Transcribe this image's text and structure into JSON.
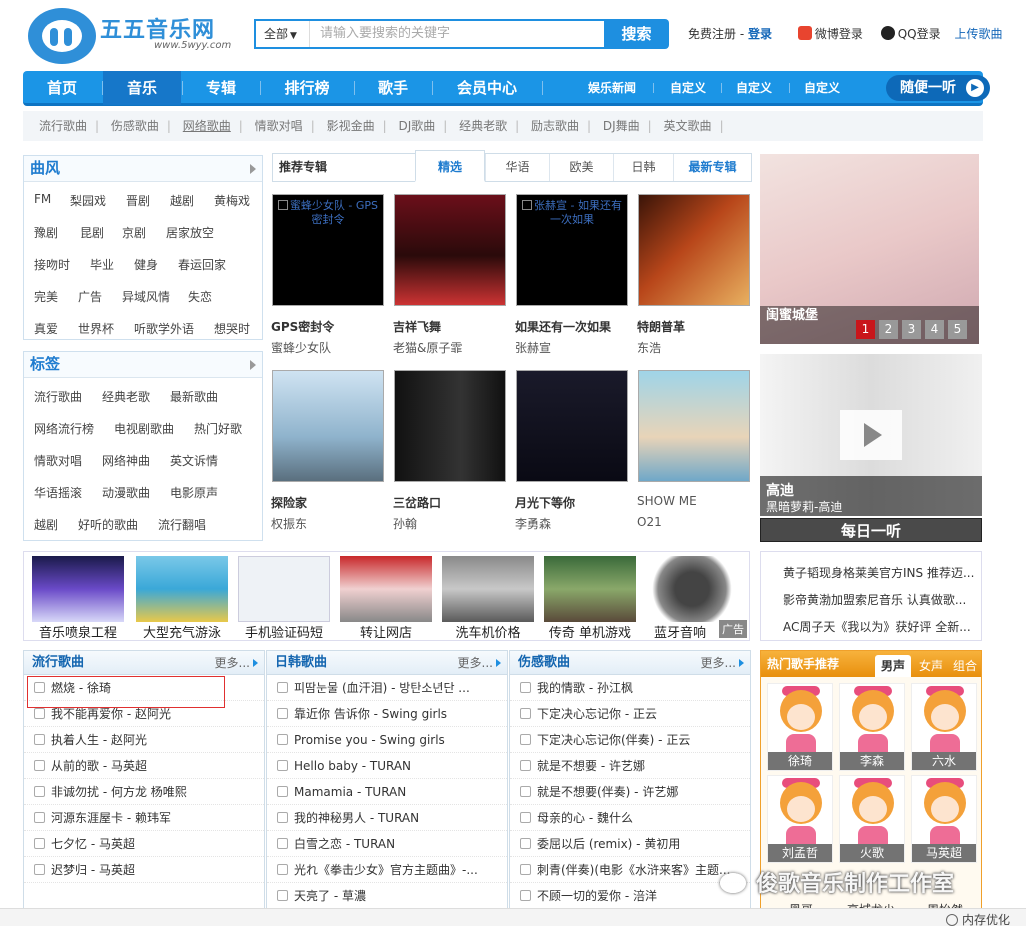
{
  "colors": {
    "brand": "#1e8fe0",
    "nav": "#1b95e6",
    "accent_red": "#c9161b",
    "singer_orange": "#f0a02a"
  },
  "logo": {
    "text": "五五音乐网",
    "url": "www.5wyy.com"
  },
  "search": {
    "scope": "全部",
    "placeholder": "请输入要搜索的关键字",
    "button": "搜索"
  },
  "top_links": {
    "register": "免费注册",
    "dash": "-",
    "login": "登录",
    "weibo": "微博登录",
    "qq": "QQ登录",
    "upload": "上传歌曲"
  },
  "nav": {
    "items": [
      "首页",
      "音乐",
      "专辑",
      "排行榜",
      "歌手",
      "会员中心"
    ],
    "small": [
      "娱乐新闻",
      "自定义",
      "自定义",
      "自定义"
    ],
    "random": "随便一听"
  },
  "subnav": [
    "流行歌曲",
    "伤感歌曲",
    "网络歌曲",
    "情歌对唱",
    "影视金曲",
    "DJ歌曲",
    "经典老歌",
    "励志歌曲",
    "DJ舞曲",
    "英文歌曲"
  ],
  "genre": {
    "title": "曲风",
    "rows": [
      [
        "FM",
        "梨园戏",
        "晋剧",
        "越剧",
        "黄梅戏"
      ],
      [
        "豫剧",
        "昆剧",
        "京剧",
        "居家放空"
      ],
      [
        "接吻时",
        "毕业",
        "健身",
        "春运回家"
      ],
      [
        "完美",
        "广告",
        "异域风情",
        "失恋"
      ],
      [
        "真爱",
        "世界杯",
        "听歌学外语",
        "想哭时"
      ]
    ]
  },
  "tags": {
    "title": "标签",
    "rows": [
      [
        "流行歌曲",
        "经典老歌",
        "最新歌曲"
      ],
      [
        "网络流行榜",
        "电视剧歌曲",
        "热门好歌"
      ],
      [
        "情歌对唱",
        "网络神曲",
        "英文诉情"
      ],
      [
        "华语摇滚",
        "动漫歌曲",
        "电影原声"
      ],
      [
        "越剧",
        "好听的歌曲",
        "流行翻唱"
      ]
    ]
  },
  "albums": {
    "title": "推荐专辑",
    "tabs": [
      "精选",
      "华语",
      "欧美",
      "日韩",
      "最新专辑"
    ],
    "items": [
      {
        "title": "GPS密封令",
        "artist": "蜜蜂少女队",
        "alt": "蜜蜂少女队 - GPS密封令",
        "broken": true
      },
      {
        "title": "吉祥飞舞",
        "artist": "老猫&原子霏",
        "alt": "",
        "broken": false
      },
      {
        "title": "如果还有一次如果",
        "artist": "张赫宣",
        "alt": "张赫宣 - 如果还有一次如果",
        "broken": true
      },
      {
        "title": "特朗普革",
        "artist": "东浩",
        "alt": "",
        "broken": false
      },
      {
        "title": "探险家",
        "artist": "权振东",
        "alt": "",
        "broken": false
      },
      {
        "title": "三岔路口",
        "artist": "孙翰",
        "alt": "",
        "broken": false
      },
      {
        "title": "月光下等你",
        "artist": "李勇森",
        "alt": "",
        "broken": false
      },
      {
        "title": "SHOW ME",
        "artist": "O21",
        "alt": "",
        "broken": false
      }
    ]
  },
  "banner": {
    "caption": "闺蜜城堡",
    "slides": [
      "1",
      "2",
      "3",
      "4",
      "5"
    ],
    "active_slide": "1"
  },
  "daily": {
    "title": "高迪",
    "subtitle": "黑暗萝莉-高迪",
    "button": "每日一听"
  },
  "ads": {
    "items": [
      "音乐喷泉工程",
      "大型充气游泳",
      "手机验证码短",
      "转让网店",
      "洗车机价格",
      "传奇 单机游戏",
      "蓝牙音响"
    ],
    "badge": "广告"
  },
  "news": [
    "黄子韬现身格莱美官方INS 推荐迈...",
    "影帝黄渤加盟索尼音乐 认真做歌...",
    "AC周子天《我以为》获好评 全新..."
  ],
  "lists": [
    {
      "title": "流行歌曲",
      "more": "更多",
      "songs": [
        "燃烧 - 徐琦",
        "我不能再爱你 - 赵阿光",
        "执着人生 - 赵阿光",
        "从前的歌 - 马英超",
        "非诚勿扰 - 何方龙 杨唯熙",
        "河源东涯屋卡 - 赖玮军",
        "七夕忆 - 马英超",
        "迟梦归 - 马英超"
      ]
    },
    {
      "title": "日韩歌曲",
      "more": "更多",
      "songs": [
        "피땀눈물 (血汗泪) - 방탄소년단 ...",
        "靠近你 告诉你 - Swing girls",
        "Promise you - Swing girls",
        "Hello baby - TURAN",
        "Mamamia - TURAN",
        "我的神秘男人 - TURAN",
        "白雪之恋 - TURAN",
        "光れ《拳击少女》官方主题曲》-...",
        "天亮了 - 草濃"
      ]
    },
    {
      "title": "伤感歌曲",
      "more": "更多",
      "songs": [
        "我的情歌 - 孙江枫",
        "下定决心忘记你 - 正云",
        "下定决心忘记你(伴奏) - 正云",
        "就是不想要 - 许艺娜",
        "就是不想要(伴奏) - 许艺娜",
        "母亲的心 - 魏什么",
        "委屈以后 (remix) - 黄初用",
        "刺青(伴奏)(电影《水浒来客》主题...",
        "不顾一切的爱你 - 涪洋"
      ]
    }
  ],
  "singers": {
    "title": "热门歌手推荐",
    "tabs": [
      "男声",
      "女声",
      "组合"
    ],
    "names": [
      "徐琦",
      "李森",
      "六水",
      "刘孟哲",
      "火歌",
      "马英超"
    ],
    "peek": [
      "黑哥",
      "高城龙少",
      "周怡然"
    ]
  },
  "watermark": "俊歌音乐制作工作室",
  "status": "内存优化"
}
